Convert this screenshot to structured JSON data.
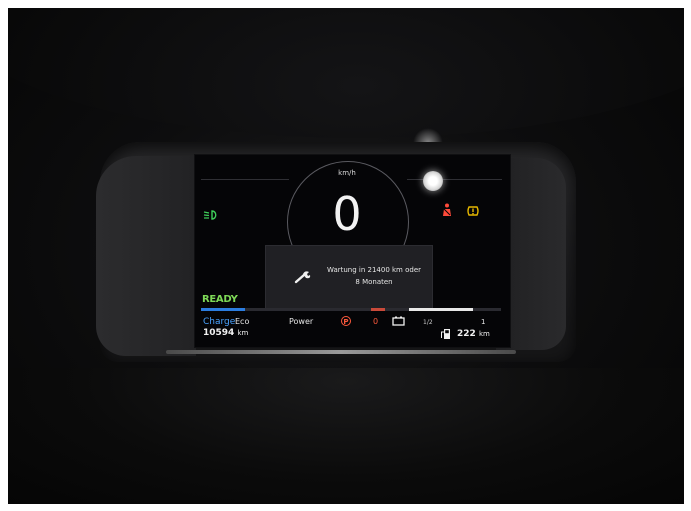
{
  "photo": {
    "description_colors": {
      "screen_bg": "#050507",
      "ready": "#7ed957",
      "charge": "#4aa3ff",
      "warning": "#ff5a3c"
    }
  },
  "cluster": {
    "speed_unit": "km/h",
    "speed_value": "0",
    "status": "READY",
    "power_labels": {
      "charge": "Charge",
      "eco": "Eco",
      "power": "Power"
    },
    "parking_brake_symbol": "P",
    "regen_value": "0",
    "gauge_half_label": "1/2",
    "gauge_full_label": "1",
    "odometer_value": "10594",
    "odometer_unit": "km",
    "range_value": "222",
    "range_unit": "km",
    "icons": [
      "low-beam-icon",
      "seatbelt-warning-icon",
      "tire-pressure-icon",
      "warning-lamp-icon",
      "wrench-icon",
      "battery-icon",
      "fuel-range-icon"
    ]
  },
  "popup": {
    "line1": "Wartung in 21400 km oder",
    "line2": "8 Monaten"
  }
}
